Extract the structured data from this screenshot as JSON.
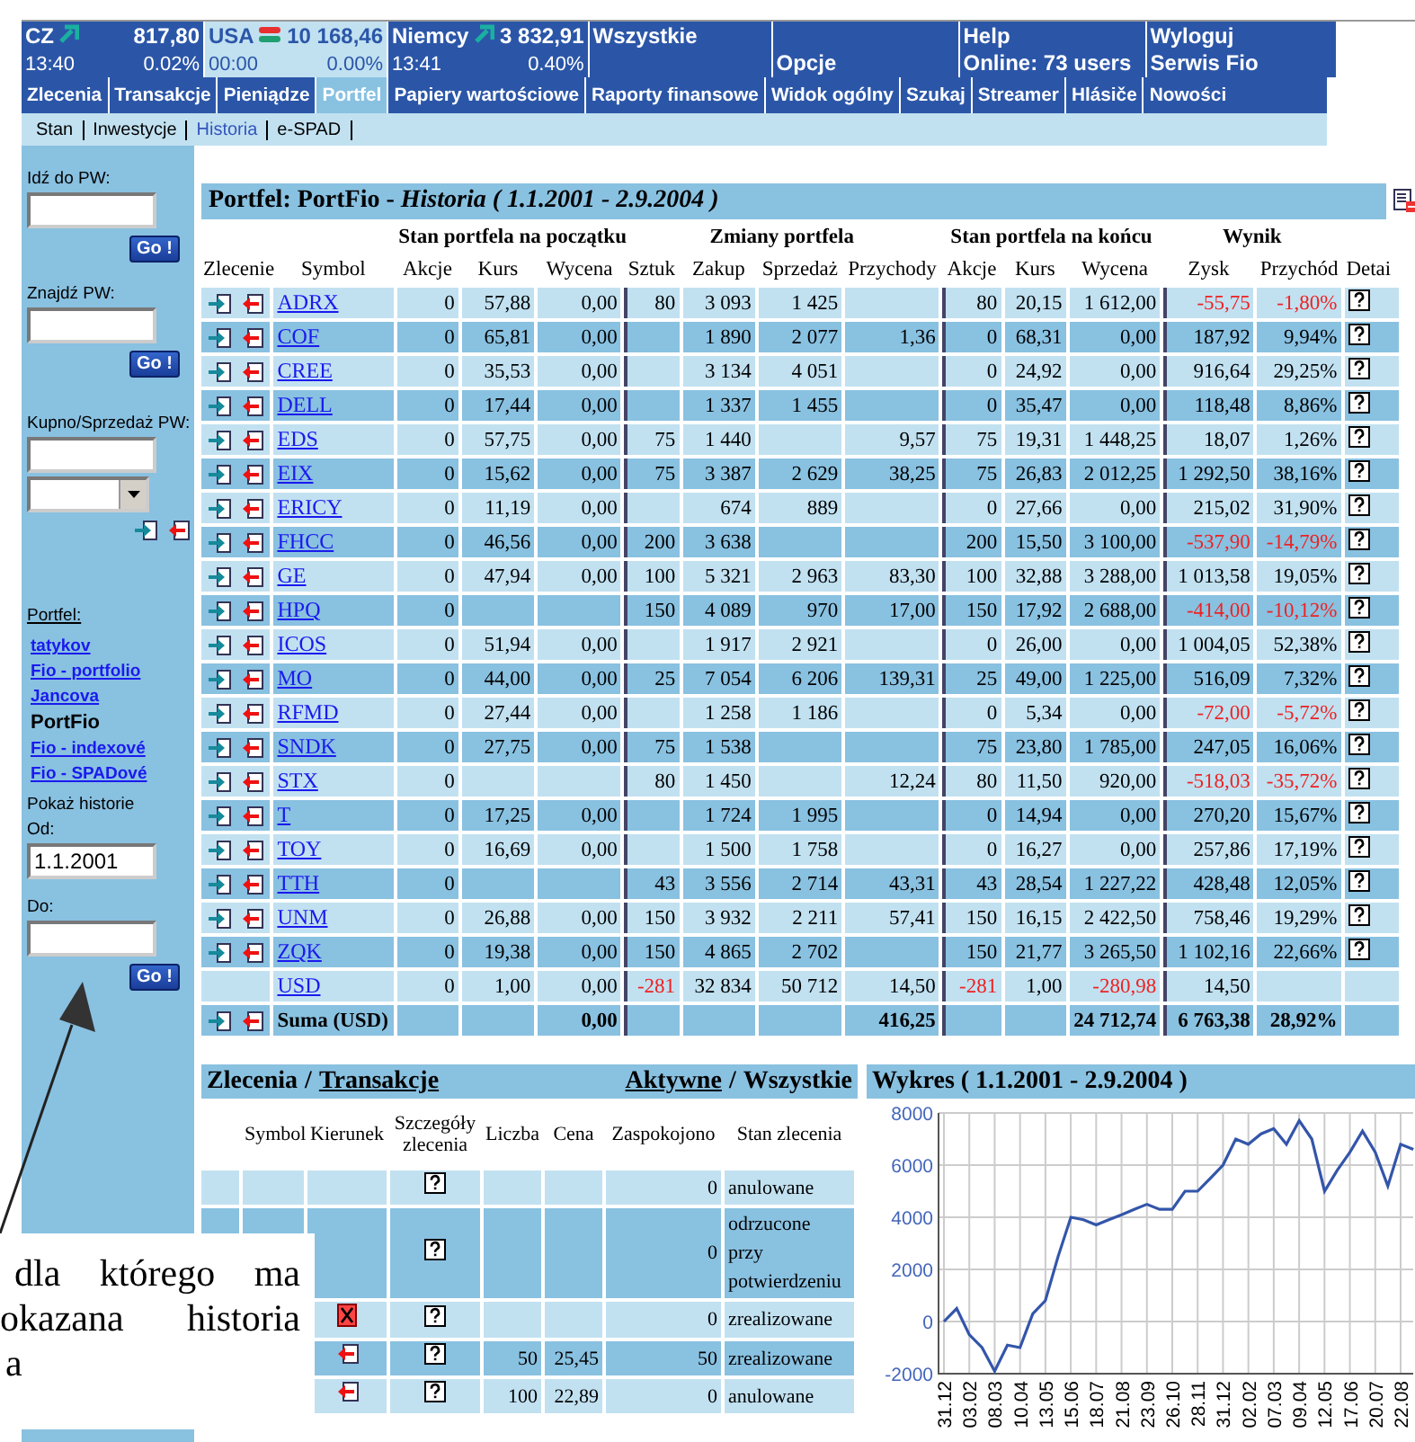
{
  "quotes": [
    {
      "label": "CZ",
      "kind": "up",
      "value": "817,80",
      "time": "13:40",
      "change": "0.02%",
      "selected": false
    },
    {
      "label": "USA",
      "kind": "mixed",
      "value": "10 168,46",
      "time": "00:00",
      "change": "0.00%",
      "selected": true
    },
    {
      "label": "Niemcy",
      "kind": "up",
      "value": "3 832,91",
      "time": "13:41",
      "change": "0.40%",
      "selected": false
    }
  ],
  "header_cells": [
    {
      "top": "Wszystkie"
    },
    {
      "bottom": "Opcje"
    },
    {
      "top": "Help",
      "bottom": "Online: 73 users"
    },
    {
      "top": "Wyloguj",
      "bottom": "Serwis Fio"
    }
  ],
  "menu": [
    {
      "label": "Zlecenia",
      "selected": false
    },
    {
      "label": "Transakcje",
      "selected": false
    },
    {
      "label": "Pieniądze",
      "selected": false
    },
    {
      "label": "Portfel",
      "selected": true
    },
    {
      "label": "Papiery wartościowe",
      "selected": false
    },
    {
      "label": "Raporty finansowe",
      "selected": false
    },
    {
      "label": "Widok ogólny",
      "selected": false
    },
    {
      "label": "Szukaj",
      "selected": false
    },
    {
      "label": "Streamer",
      "selected": false
    },
    {
      "label": "Hlásiče",
      "selected": false
    },
    {
      "label": "Nowości",
      "selected": false
    }
  ],
  "submenu": [
    {
      "label": "Stan",
      "selected": false
    },
    {
      "label": "Inwestycje",
      "selected": false
    },
    {
      "label": "Historia",
      "selected": true
    },
    {
      "label": "e-SPAD",
      "selected": false
    }
  ],
  "sidebar": {
    "goto": {
      "label": "Idź do PW:",
      "button": "Go !"
    },
    "find": {
      "label": "Znajdź PW:",
      "button": "Go !"
    },
    "trade": {
      "label": "Kupno/Sprzedaż PW:"
    },
    "portfolio_label": "Portfel:",
    "portfolios": [
      {
        "label": "tatykov",
        "selected": false
      },
      {
        "label": "Fio - portfolio",
        "selected": false
      },
      {
        "label": "Jancova",
        "selected": false
      },
      {
        "label": "PortFio",
        "selected": true
      },
      {
        "label": "Fio - indexové",
        "selected": false
      },
      {
        "label": "Fio - SPADové",
        "selected": false
      }
    ],
    "history": {
      "label": "Pokaż historie",
      "from_label": "Od:",
      "from_value": "1.1.2001",
      "to_label": "Do:",
      "button": "Go !"
    }
  },
  "portfolio_table": {
    "title": "Portfel: PortFio - *Historia ( 1.1.2001 - 2.9.2004 )*",
    "header": [
      {
        "label": "Zlecenie"
      },
      {
        "label": "Symbol"
      },
      {
        "group": "Stan portfela na początku",
        "columns": [
          "Akcje",
          "Kurs",
          "Wycena"
        ]
      },
      {
        "group": "Zmiany portfela",
        "columns": [
          "Sztuk",
          "Zakup",
          "Sprzedaż",
          "Przychody"
        ]
      },
      {
        "group": "Stan portfela na końcu",
        "columns": [
          "Akcje",
          "Kurs",
          "Wycena"
        ]
      },
      {
        "group": "Wynik",
        "columns": [
          "Zysk",
          "Przychód"
        ]
      },
      {
        "label": "Detai"
      }
    ],
    "rows": [
      {
        "kind": "stock",
        "symbol": "ADRX",
        "cells": [
          "0",
          "57,88",
          "0,00",
          "80",
          "3 093",
          "1 425",
          null,
          "80",
          "20,15",
          "1 612,00",
          "-55,75",
          "-1,80%"
        ],
        "negative_result": true,
        "negative_position": false
      },
      {
        "kind": "stock",
        "symbol": "COF",
        "cells": [
          "0",
          "65,81",
          "0,00",
          null,
          "1 890",
          "2 077",
          "1,36",
          "0",
          "68,31",
          "0,00",
          "187,92",
          "9,94%"
        ],
        "negative_result": false,
        "negative_position": false
      },
      {
        "kind": "stock",
        "symbol": "CREE",
        "cells": [
          "0",
          "35,53",
          "0,00",
          null,
          "3 134",
          "4 051",
          null,
          "0",
          "24,92",
          "0,00",
          "916,64",
          "29,25%"
        ],
        "negative_result": false,
        "negative_position": false
      },
      {
        "kind": "stock",
        "symbol": "DELL",
        "cells": [
          "0",
          "17,44",
          "0,00",
          null,
          "1 337",
          "1 455",
          null,
          "0",
          "35,47",
          "0,00",
          "118,48",
          "8,86%"
        ],
        "negative_result": false,
        "negative_position": false
      },
      {
        "kind": "stock",
        "symbol": "EDS",
        "cells": [
          "0",
          "57,75",
          "0,00",
          "75",
          "1 440",
          null,
          "9,57",
          "75",
          "19,31",
          "1 448,25",
          "18,07",
          "1,26%"
        ],
        "negative_result": false,
        "negative_position": false
      },
      {
        "kind": "stock",
        "symbol": "EIX",
        "cells": [
          "0",
          "15,62",
          "0,00",
          "75",
          "3 387",
          "2 629",
          "38,25",
          "75",
          "26,83",
          "2 012,25",
          "1 292,50",
          "38,16%"
        ],
        "negative_result": false,
        "negative_position": false
      },
      {
        "kind": "stock",
        "symbol": "ERICY",
        "cells": [
          "0",
          "11,19",
          "0,00",
          null,
          "674",
          "889",
          null,
          "0",
          "27,66",
          "0,00",
          "215,02",
          "31,90%"
        ],
        "negative_result": false,
        "negative_position": false
      },
      {
        "kind": "stock",
        "symbol": "FHCC",
        "cells": [
          "0",
          "46,56",
          "0,00",
          "200",
          "3 638",
          null,
          null,
          "200",
          "15,50",
          "3 100,00",
          "-537,90",
          "-14,79%"
        ],
        "negative_result": true,
        "negative_position": false
      },
      {
        "kind": "stock",
        "symbol": "GE",
        "cells": [
          "0",
          "47,94",
          "0,00",
          "100",
          "5 321",
          "2 963",
          "83,30",
          "100",
          "32,88",
          "3 288,00",
          "1 013,58",
          "19,05%"
        ],
        "negative_result": false,
        "negative_position": false
      },
      {
        "kind": "stock",
        "symbol": "HPQ",
        "cells": [
          "0",
          null,
          null,
          "150",
          "4 089",
          "970",
          "17,00",
          "150",
          "17,92",
          "2 688,00",
          "-414,00",
          "-10,12%"
        ],
        "negative_result": true,
        "negative_position": false
      },
      {
        "kind": "stock",
        "symbol": "ICOS",
        "cells": [
          "0",
          "51,94",
          "0,00",
          null,
          "1 917",
          "2 921",
          null,
          "0",
          "26,00",
          "0,00",
          "1 004,05",
          "52,38%"
        ],
        "negative_result": false,
        "negative_position": false
      },
      {
        "kind": "stock",
        "symbol": "MO",
        "cells": [
          "0",
          "44,00",
          "0,00",
          "25",
          "7 054",
          "6 206",
          "139,31",
          "25",
          "49,00",
          "1 225,00",
          "516,09",
          "7,32%"
        ],
        "negative_result": false,
        "negative_position": false
      },
      {
        "kind": "stock",
        "symbol": "RFMD",
        "cells": [
          "0",
          "27,44",
          "0,00",
          null,
          "1 258",
          "1 186",
          null,
          "0",
          "5,34",
          "0,00",
          "-72,00",
          "-5,72%"
        ],
        "negative_result": true,
        "negative_position": false
      },
      {
        "kind": "stock",
        "symbol": "SNDK",
        "cells": [
          "0",
          "27,75",
          "0,00",
          "75",
          "1 538",
          null,
          null,
          "75",
          "23,80",
          "1 785,00",
          "247,05",
          "16,06%"
        ],
        "negative_result": false,
        "negative_position": false
      },
      {
        "kind": "stock",
        "symbol": "STX",
        "cells": [
          "0",
          null,
          null,
          "80",
          "1 450",
          null,
          "12,24",
          "80",
          "11,50",
          "920,00",
          "-518,03",
          "-35,72%"
        ],
        "negative_result": true,
        "negative_position": false
      },
      {
        "kind": "stock",
        "symbol": "T",
        "cells": [
          "0",
          "17,25",
          "0,00",
          null,
          "1 724",
          "1 995",
          null,
          "0",
          "14,94",
          "0,00",
          "270,20",
          "15,67%"
        ],
        "negative_result": false,
        "negative_position": false
      },
      {
        "kind": "stock",
        "symbol": "TOY",
        "cells": [
          "0",
          "16,69",
          "0,00",
          null,
          "1 500",
          "1 758",
          null,
          "0",
          "16,27",
          "0,00",
          "257,86",
          "17,19%"
        ],
        "negative_result": false,
        "negative_position": false
      },
      {
        "kind": "stock",
        "symbol": "TTH",
        "cells": [
          "0",
          null,
          null,
          "43",
          "3 556",
          "2 714",
          "43,31",
          "43",
          "28,54",
          "1 227,22",
          "428,48",
          "12,05%"
        ],
        "negative_result": false,
        "negative_position": false
      },
      {
        "kind": "stock",
        "symbol": "UNM",
        "cells": [
          "0",
          "26,88",
          "0,00",
          "150",
          "3 932",
          "2 211",
          "57,41",
          "150",
          "16,15",
          "2 422,50",
          "758,46",
          "19,29%"
        ],
        "negative_result": false,
        "negative_position": false
      },
      {
        "kind": "stock",
        "symbol": "ZQK",
        "cells": [
          "0",
          "19,38",
          "0,00",
          "150",
          "4 865",
          "2 702",
          null,
          "150",
          "21,77",
          "3 265,50",
          "1 102,16",
          "22,66%"
        ],
        "negative_result": false,
        "negative_position": false
      },
      {
        "kind": "cash",
        "symbol": "USD",
        "cells": [
          "0",
          "1,00",
          "0,00",
          "-281",
          "32 834",
          "50 712",
          "14,50",
          "-281",
          "1,00",
          "-280,98",
          "14,50",
          null
        ],
        "negative_result": false,
        "negative_position": true
      },
      {
        "kind": "total",
        "symbol": "Suma (USD)",
        "cells": [
          null,
          null,
          "0,00",
          null,
          null,
          null,
          "416,25",
          null,
          null,
          "24 712,74",
          "6 763,38",
          "28,92%"
        ],
        "negative_result": false,
        "negative_position": false
      }
    ]
  },
  "orders": {
    "separator": "/",
    "title_tabs": [
      {
        "label": "Zlecenia",
        "selected": true
      },
      {
        "label": "Transakcje",
        "selected": false
      }
    ],
    "filter_tabs": [
      {
        "label": "Aktywne",
        "selected": false
      },
      {
        "label": "Wszystkie",
        "selected": true
      }
    ],
    "columns": [
      "Symbol",
      "Kierunek",
      "Szczegóły zlecenia",
      "Liczba",
      "Cena",
      "Zaspokojono",
      "Stan zlecenia"
    ],
    "rows": [
      {
        "kind": "plain",
        "quantity": null,
        "price": null,
        "filled": "0",
        "status": "anulowane"
      },
      {
        "kind": "plain",
        "quantity": null,
        "price": null,
        "filled": "0",
        "status": "odrzucone przy potwierdzeniu"
      },
      {
        "kind": "cancelled",
        "quantity": null,
        "price": null,
        "filled": "0",
        "status": "zrealizowane"
      },
      {
        "kind": "sell",
        "quantity": "50",
        "price": "25,45",
        "filled": "50",
        "status": "zrealizowane"
      },
      {
        "kind": "sell",
        "quantity": "100",
        "price": "22,89",
        "filled": "0",
        "status": "anulowane"
      }
    ]
  },
  "chart": {
    "title": "Wykres ( 1.1.2001 - 2.9.2004 )",
    "chart_data": {
      "type": "line",
      "grid": true,
      "ylim": [
        -2000,
        8000
      ],
      "yticks": [
        -2000,
        0,
        2000,
        4000,
        6000,
        8000
      ],
      "categories": [
        "31.12",
        null,
        "03.02",
        null,
        "08.03",
        null,
        "10.04",
        null,
        "13.05",
        null,
        "15.06",
        null,
        "18.07",
        null,
        "21.08",
        null,
        "23.09",
        null,
        "26.10",
        null,
        "28.11",
        null,
        "31.12",
        null,
        "02.02",
        null,
        "07.03",
        null,
        "09.04",
        null,
        "12.05",
        null,
        "17.06",
        null,
        "20.07",
        null,
        "22.08",
        null
      ],
      "series": [
        {
          "color": "#3355aa",
          "values": [
            0,
            500,
            -500,
            -1000,
            -1900,
            -900,
            -1000,
            300,
            800,
            2500,
            4000,
            3900,
            3700,
            3900,
            4100,
            4300,
            4500,
            4300,
            4300,
            5000,
            5000,
            5500,
            6000,
            7000,
            6800,
            7200,
            7400,
            6800,
            7700,
            7000,
            5000,
            5800,
            6500,
            7300,
            6500,
            5200,
            6800,
            6600
          ]
        }
      ]
    }
  },
  "annotation": {
    "lines": [
      "dla którego ma",
      "okazana historia",
      "a"
    ]
  }
}
